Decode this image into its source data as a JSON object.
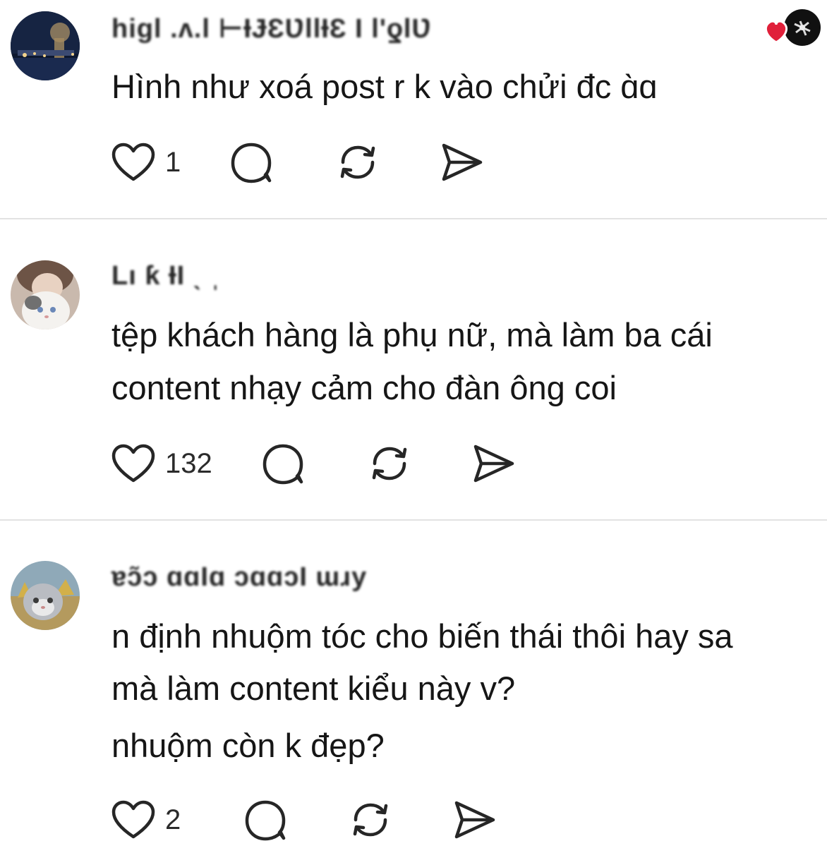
{
  "comments": [
    {
      "username": "higl .ʌ.l  ⊢ƗɈƐƲllƗƐ Ɩ l'ƍlƲ",
      "lines": [
        "Hình như xoá post r k vào chửi đc ɑ̀ɑ"
      ],
      "likes": "1",
      "avatar_icon": "avatar-night-city",
      "liked_badge": "heart-icon"
    },
    {
      "username": "Lı ƙ  ƗƖ   ˎ      ˌ",
      "lines": [
        "tệp khách hàng là phụ nữ, mà làm ba cái",
        "content nhạy cảm cho đàn ông coi"
      ],
      "likes": "132",
      "avatar_icon": "avatar-cat-girl"
    },
    {
      "username": "ɐɔ̃ɔ ɑɑƖɑ ɔɑɑɔƖ ɯɹy",
      "lines": [
        "n định nhuộm tóc cho biến thái thôi hay sa",
        "mà làm content kiểu này v?",
        "nhuộm còn k đẹp?"
      ],
      "likes": "2",
      "avatar_icon": "avatar-cat-field"
    }
  ],
  "icons": {
    "like": "heart-outline-icon",
    "reply": "speech-bubble-icon",
    "repost": "repost-icon",
    "share": "send-icon"
  },
  "colors": {
    "heart_badge": "#e0203a",
    "divider": "#e2e2e2",
    "text": "#161616"
  }
}
